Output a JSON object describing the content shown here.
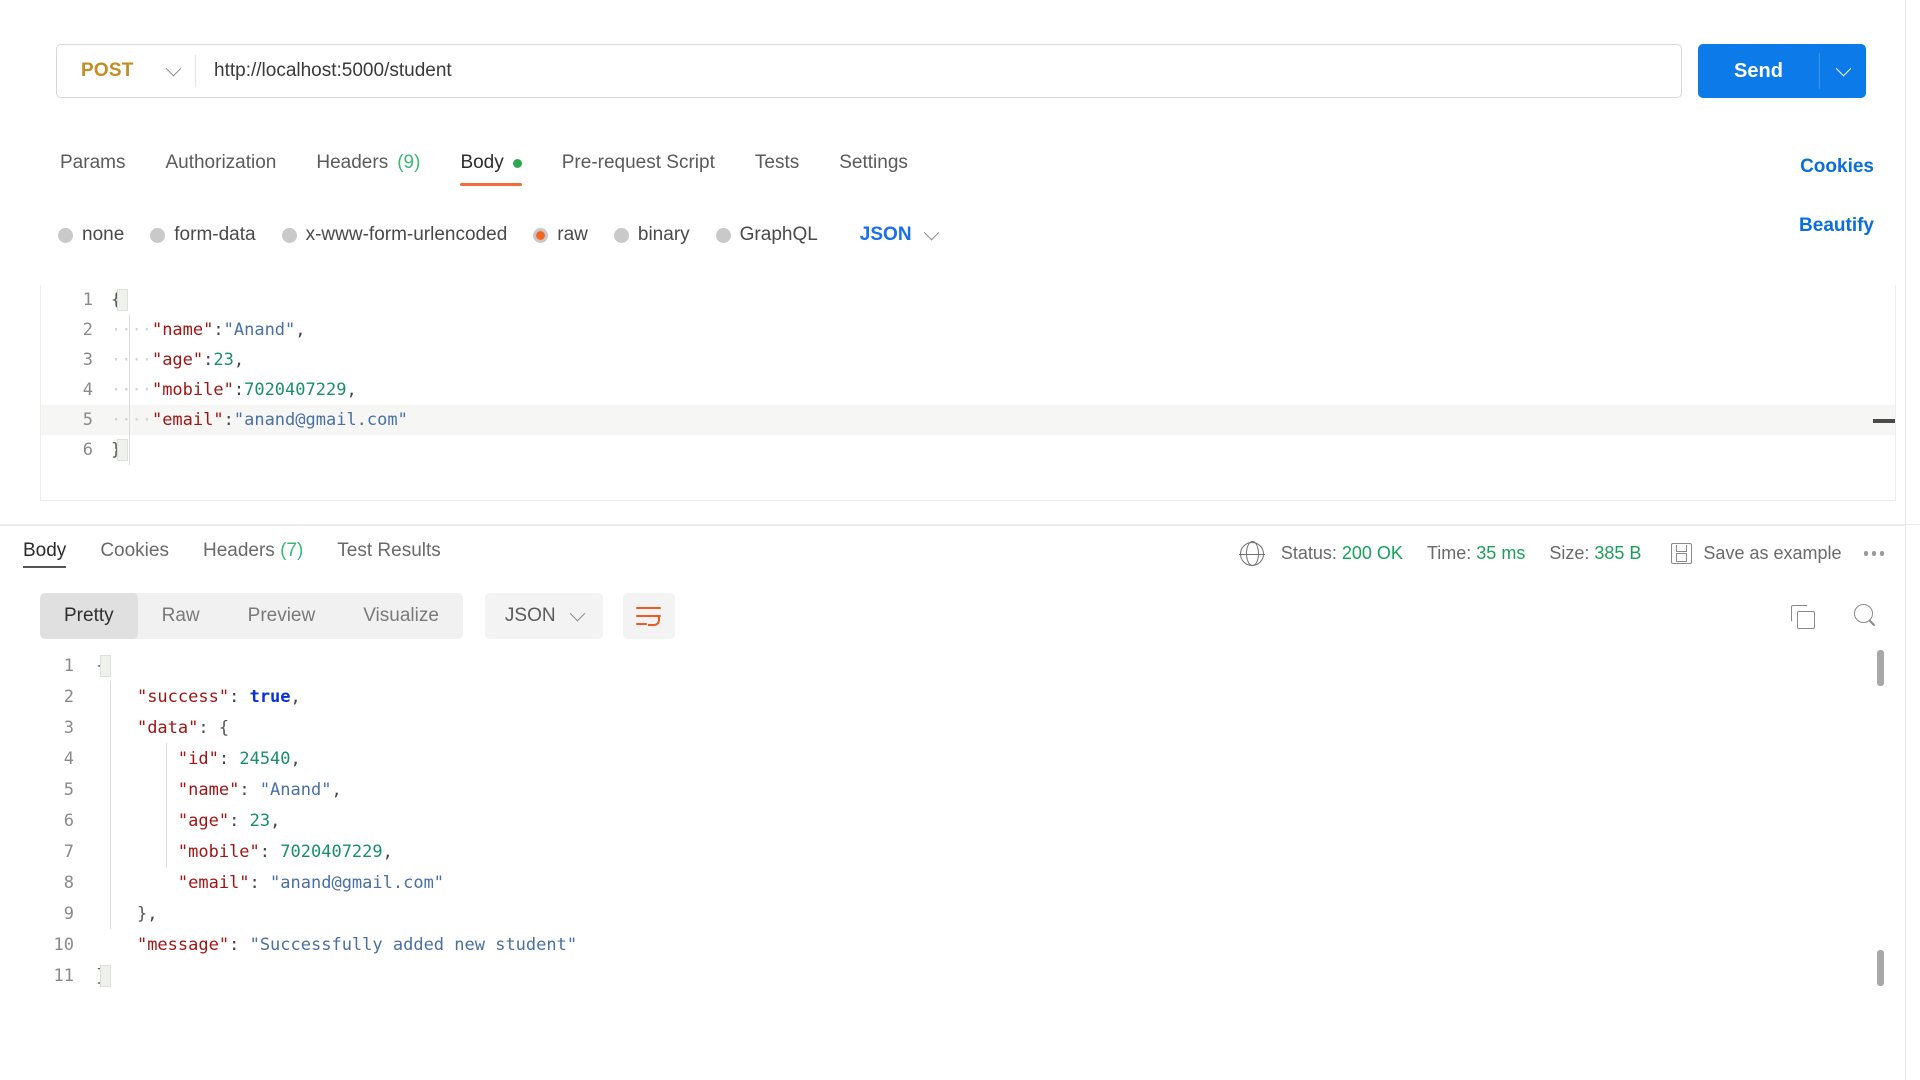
{
  "request": {
    "method": "POST",
    "url": "http://localhost:5000/student",
    "send_label": "Send",
    "tabs": [
      {
        "label": "Params",
        "count": "",
        "active": false,
        "dot": false
      },
      {
        "label": "Authorization",
        "count": "",
        "active": false,
        "dot": false
      },
      {
        "label": "Headers",
        "count": "(9)",
        "active": false,
        "dot": false
      },
      {
        "label": "Body",
        "count": "",
        "active": true,
        "dot": true
      },
      {
        "label": "Pre-request Script",
        "count": "",
        "active": false,
        "dot": false
      },
      {
        "label": "Tests",
        "count": "",
        "active": false,
        "dot": false
      },
      {
        "label": "Settings",
        "count": "",
        "active": false,
        "dot": false
      }
    ],
    "cookies_link": "Cookies",
    "beautify_link": "Beautify",
    "body_types": [
      {
        "label": "none",
        "selected": false
      },
      {
        "label": "form-data",
        "selected": false
      },
      {
        "label": "x-www-form-urlencoded",
        "selected": false
      },
      {
        "label": "raw",
        "selected": true
      },
      {
        "label": "binary",
        "selected": false
      },
      {
        "label": "GraphQL",
        "selected": false
      }
    ],
    "raw_format": "JSON",
    "body_lines": [
      {
        "no": "1",
        "text": "{"
      },
      {
        "no": "2",
        "text": "    \"name\":\"Anand\","
      },
      {
        "no": "3",
        "text": "    \"age\":23,"
      },
      {
        "no": "4",
        "text": "    \"mobile\":7020407229,"
      },
      {
        "no": "5",
        "text": "    \"email\":\"anand@gmail.com\""
      },
      {
        "no": "6",
        "text": "}"
      }
    ]
  },
  "response": {
    "tabs": [
      {
        "label": "Body",
        "count": "",
        "active": true
      },
      {
        "label": "Cookies",
        "count": "",
        "active": false
      },
      {
        "label": "Headers",
        "count": "(7)",
        "active": false
      },
      {
        "label": "Test Results",
        "count": "",
        "active": false
      }
    ],
    "status_label": "Status:",
    "status_value": "200 OK",
    "time_label": "Time:",
    "time_value": "35 ms",
    "size_label": "Size:",
    "size_value": "385 B",
    "save_as_example": "Save as example",
    "view_modes": [
      {
        "label": "Pretty",
        "active": true
      },
      {
        "label": "Raw",
        "active": false
      },
      {
        "label": "Preview",
        "active": false
      },
      {
        "label": "Visualize",
        "active": false
      }
    ],
    "format": "JSON",
    "body_lines": [
      {
        "no": "1",
        "text": "{"
      },
      {
        "no": "2",
        "text": "    \"success\": true,"
      },
      {
        "no": "3",
        "text": "    \"data\": {"
      },
      {
        "no": "4",
        "text": "        \"id\": 24540,"
      },
      {
        "no": "5",
        "text": "        \"name\": \"Anand\","
      },
      {
        "no": "6",
        "text": "        \"age\": 23,"
      },
      {
        "no": "7",
        "text": "        \"mobile\": 7020407229,"
      },
      {
        "no": "8",
        "text": "        \"email\": \"anand@gmail.com\""
      },
      {
        "no": "9",
        "text": "    },"
      },
      {
        "no": "10",
        "text": "    \"message\": \"Successfully added new student\""
      },
      {
        "no": "11",
        "text": "}"
      }
    ]
  },
  "colors": {
    "accent_orange": "#f26b3a",
    "send_blue": "#0c7ae8",
    "link_blue": "#0a6ee0",
    "method_orange": "#c78b23",
    "status_green": "#1aa05a",
    "key_red": "#a31515",
    "string_blue": "#4a6fa5",
    "number_green": "#1a8f6e",
    "bool_blue": "#0a31d6"
  }
}
